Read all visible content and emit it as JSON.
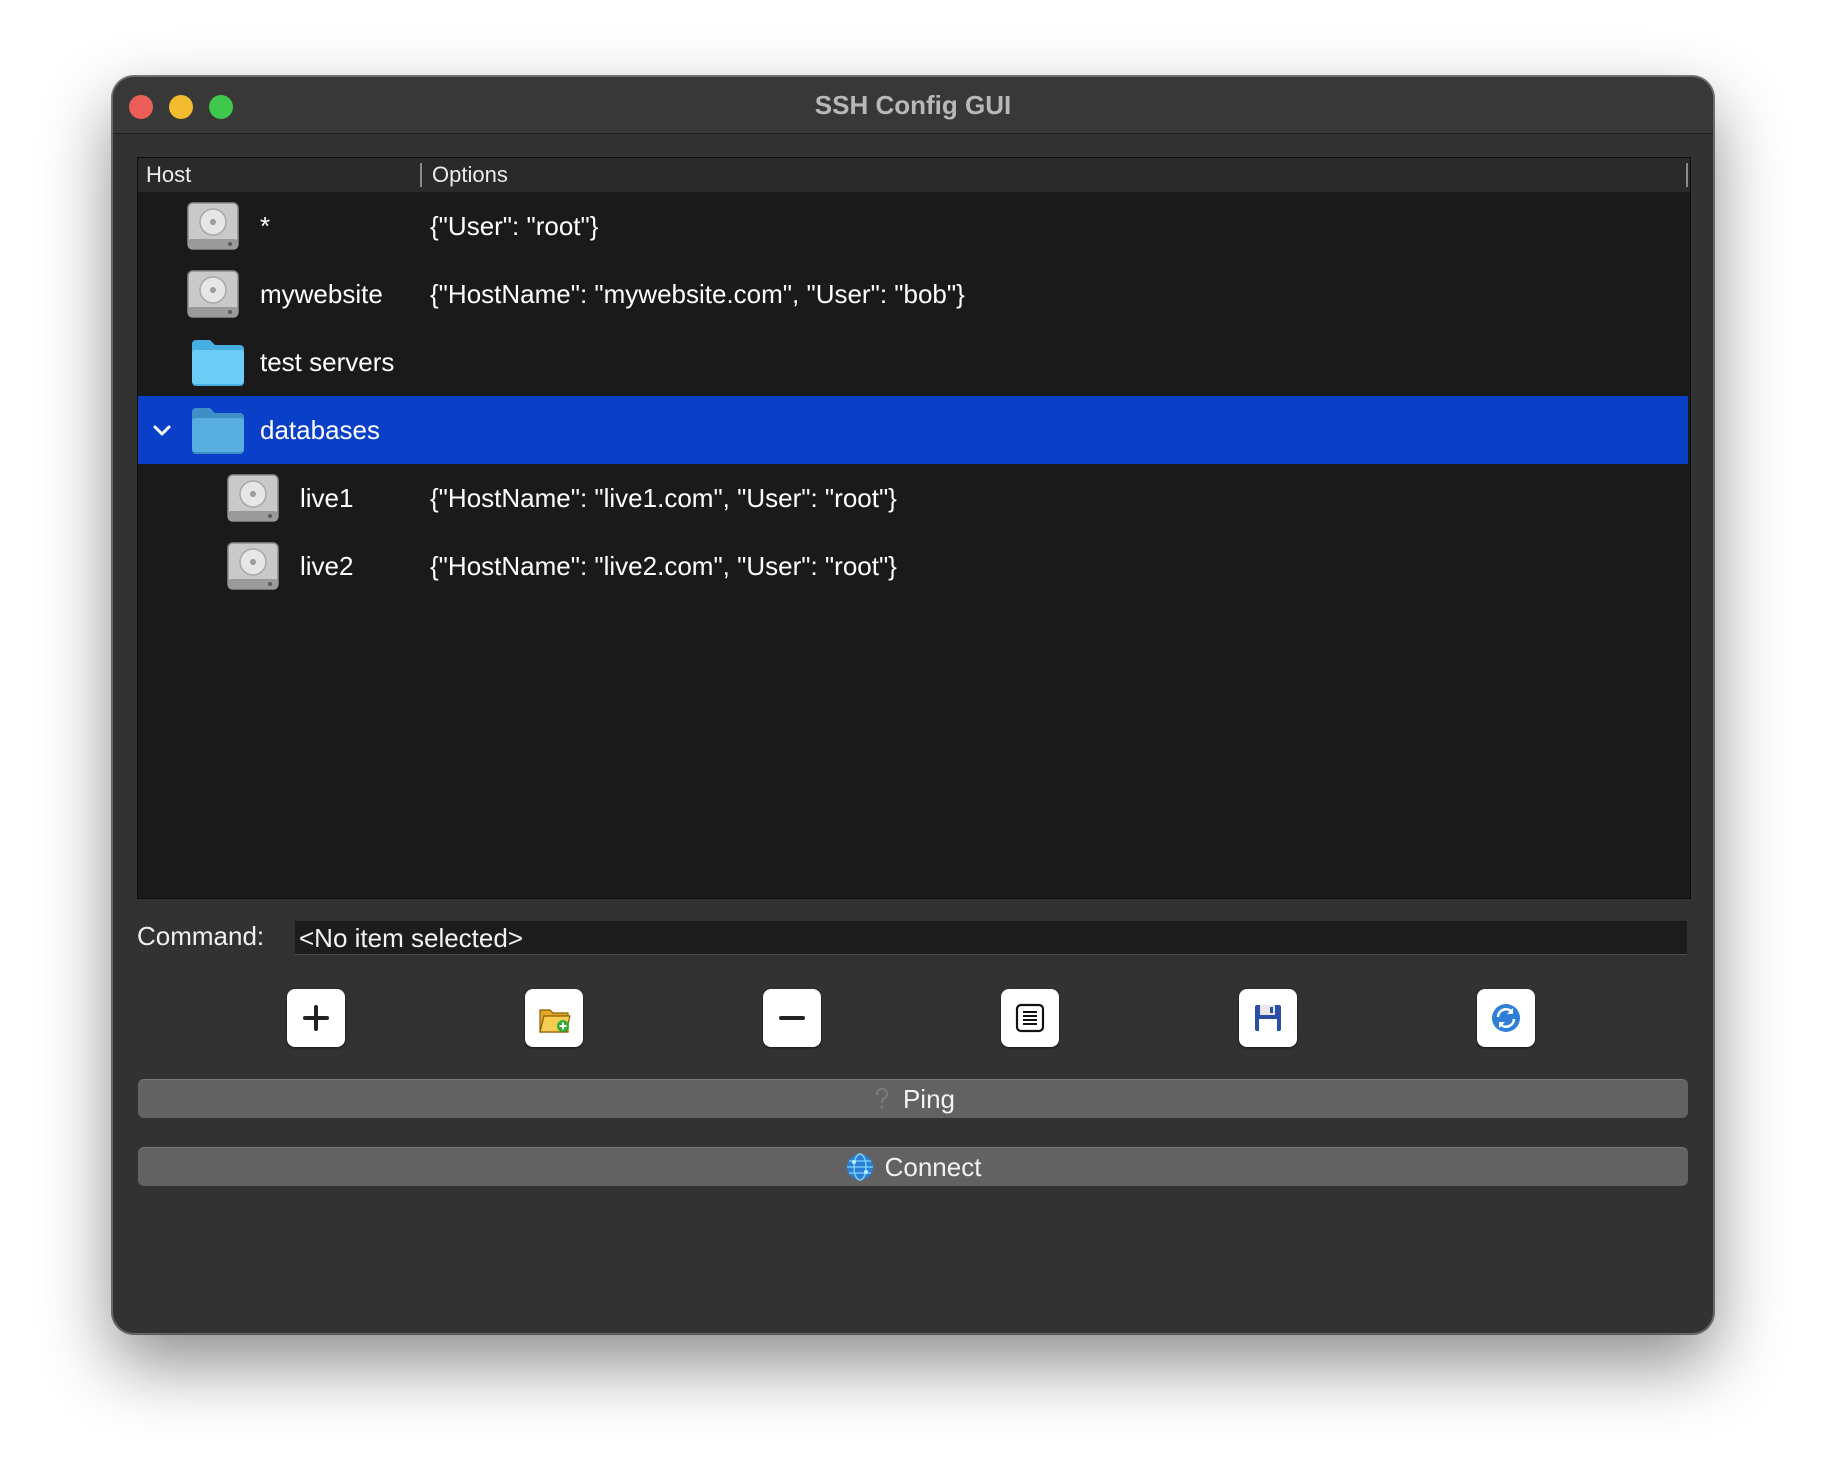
{
  "window": {
    "title": "SSH Config GUI"
  },
  "tree": {
    "columns": [
      "Host",
      "Options"
    ],
    "rows": [
      {
        "host": "*",
        "options": "{\"User\": \"root\"}",
        "type": "host",
        "level": 0
      },
      {
        "host": "mywebsite",
        "options": "{\"HostName\": \"mywebsite.com\", \"User\": \"bob\"}",
        "type": "host",
        "level": 0
      },
      {
        "host": "test servers",
        "options": "",
        "type": "folder",
        "level": 0
      },
      {
        "host": "databases",
        "options": "",
        "type": "folder",
        "level": 0,
        "expanded": true,
        "selected": true
      },
      {
        "host": "live1",
        "options": "{\"HostName\": \"live1.com\", \"User\": \"root\"}",
        "type": "host",
        "level": 1
      },
      {
        "host": "live2",
        "options": "{\"HostName\": \"live2.com\", \"User\": \"root\"}",
        "type": "host",
        "level": 1
      }
    ]
  },
  "command": {
    "label": "Command:",
    "value": "<No item selected>"
  },
  "toolbar": {
    "icons": [
      "add-icon",
      "add-folder-icon",
      "remove-icon",
      "edit-icon",
      "save-icon",
      "refresh-icon"
    ]
  },
  "buttons": {
    "ping_label": "Ping",
    "connect_label": "Connect"
  },
  "colors": {
    "selection": "#0a40c8",
    "window_bg": "#323232",
    "tree_bg": "#1a1a1a",
    "folder": "#5ec8f5"
  }
}
